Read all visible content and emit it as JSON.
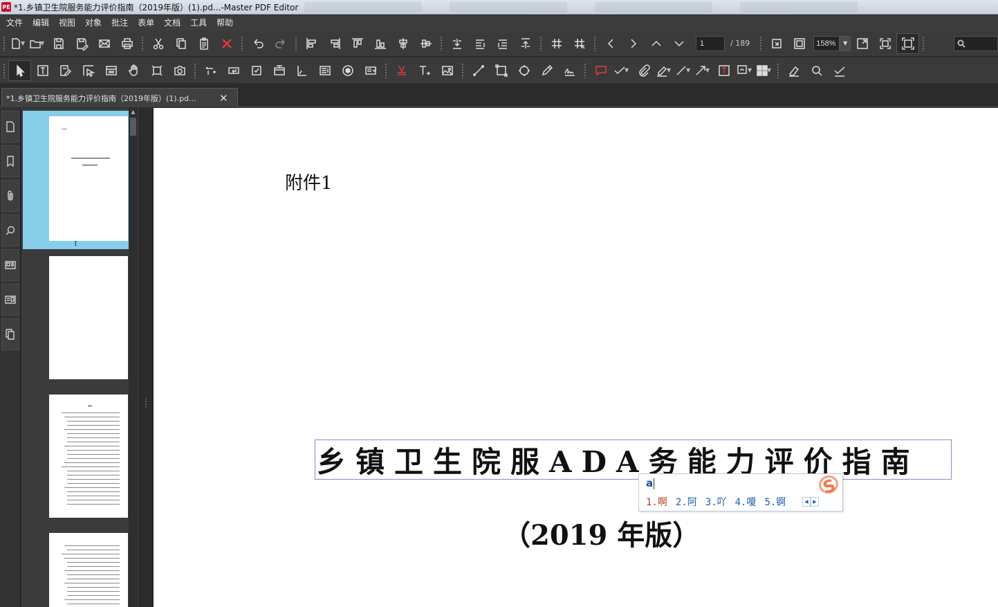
{
  "window": {
    "title": "*1.乡镇卫生院服务能力评价指南（2019年版）(1).pd...-Master PDF Editor",
    "logo_text": "PE"
  },
  "menu": [
    "文件",
    "编辑",
    "视图",
    "对象",
    "批注",
    "表单",
    "文档",
    "工具",
    "帮助"
  ],
  "toolbar": {
    "page_current": "1",
    "page_total": "/ 189",
    "zoom": "158%"
  },
  "tab": {
    "label": "*1.乡镇卫生院服务能力评价指南（2019年版）(1).pd..."
  },
  "thumbnails": {
    "page1_number": "1"
  },
  "document": {
    "annex": "附件1",
    "title": "乡镇卫生院服ADA务能力评价指南",
    "subtitle": "（2019 年版）"
  },
  "ime": {
    "input": "a",
    "logo": "S",
    "candidates": [
      "1.啊",
      "2.阿",
      "3.吖",
      "4.嗄",
      "5.锕"
    ]
  },
  "colors": {
    "thumb_selected": "#87ceeb",
    "ime_first": "#c0392b",
    "ime_text": "#1a5fa8",
    "delete_red": "#e23b3b"
  }
}
